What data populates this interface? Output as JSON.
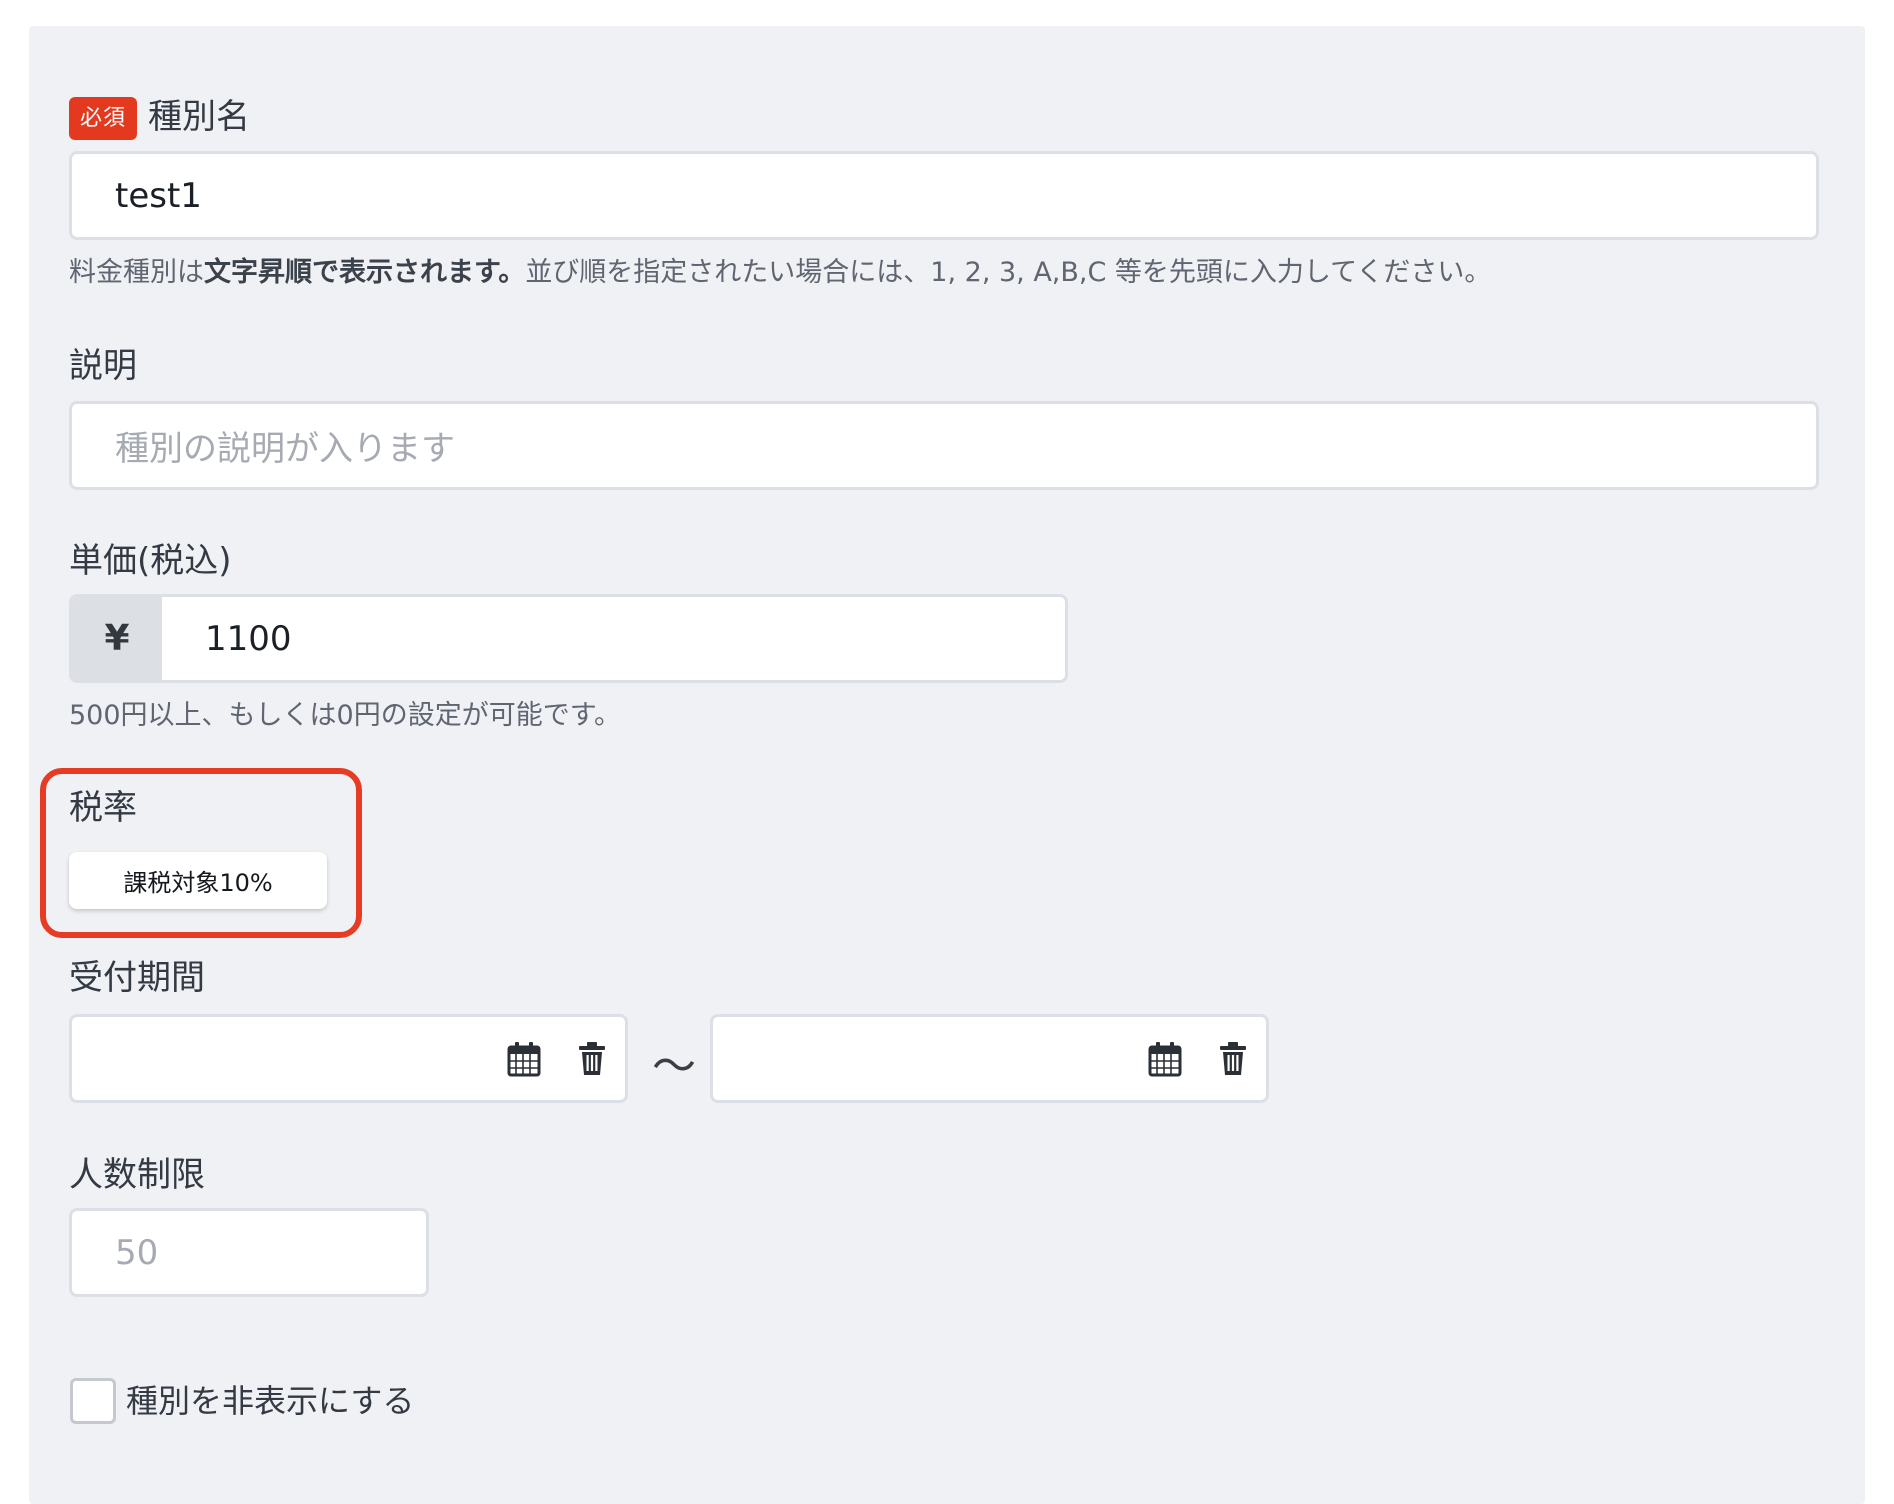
{
  "fields": {
    "type_name": {
      "required_badge": "必須",
      "label": "種別名",
      "value": "test1",
      "help_prefix": "料金種別は",
      "help_bold": "文字昇順で表示されます。",
      "help_suffix": "並び順を指定されたい場合には、1, 2, 3, A,B,C 等を先頭に入力してください。"
    },
    "description": {
      "label": "説明",
      "placeholder": "種別の説明が入ります"
    },
    "unit_price": {
      "label": "単価(税込)",
      "currency_symbol": "¥",
      "value": "1100",
      "help": "500円以上、もしくは0円の設定が可能です。"
    },
    "tax_rate": {
      "label": "税率",
      "selected": "課税対象10%"
    },
    "reception_period": {
      "label": "受付期間",
      "separator": "〜",
      "start_value": "",
      "end_value": ""
    },
    "capacity": {
      "label": "人数制限",
      "placeholder": "50"
    },
    "hide": {
      "label": "種別を非表示にする",
      "checked": false
    }
  },
  "icons": {
    "calendar": "calendar-icon",
    "trash": "trash-icon"
  },
  "colors": {
    "panel_bg": "#f0f1f4",
    "required_badge": "#e33a1f",
    "highlight": "#e63b24"
  }
}
